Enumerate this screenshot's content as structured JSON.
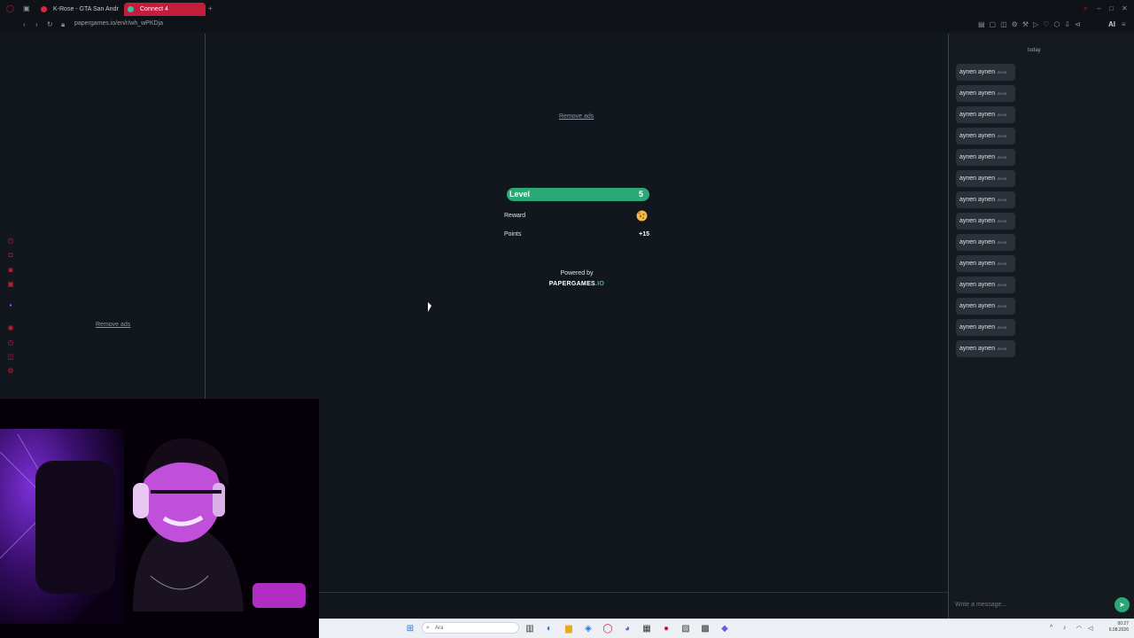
{
  "browser": {
    "tabs": [
      {
        "label": "K-Rose - GTA San Andr",
        "color": "#e0243f"
      },
      {
        "label": "Connect 4",
        "color": "#ffffff"
      }
    ],
    "new_tab": "+",
    "url": "papergames.io/en/r/wh_wPKDja",
    "ai_label": "AI",
    "accent": "#c41c3b"
  },
  "left_panel": {
    "remove_ads": "Remove ads"
  },
  "main": {
    "remove_ads": "Remove ads",
    "level": {
      "label": "Level",
      "value": "5",
      "bar_color": "#2aa876"
    },
    "reward": {
      "label": "Reward",
      "icon": "cookie-icon"
    },
    "points": {
      "label": "Points",
      "value": "+15"
    },
    "powered_by": "Powered by",
    "logo_main": "PAPERGAMES",
    "logo_tld": ".IO"
  },
  "chat": {
    "date_label": "today",
    "messages": [
      {
        "text": "aynen aynen",
        "time": "00:24"
      },
      {
        "text": "aynen aynen",
        "time": "00:24"
      },
      {
        "text": "aynen aynen",
        "time": "00:24"
      },
      {
        "text": "aynen aynen",
        "time": "00:24"
      },
      {
        "text": "aynen aynen",
        "time": "00:24"
      },
      {
        "text": "aynen aynen",
        "time": "00:24"
      },
      {
        "text": "aynen aynen",
        "time": "00:24"
      },
      {
        "text": "aynen aynen",
        "time": "00:24"
      },
      {
        "text": "aynen aynen",
        "time": "00:24"
      },
      {
        "text": "aynen aynen",
        "time": "00:24"
      },
      {
        "text": "aynen aynen",
        "time": "00:24"
      },
      {
        "text": "aynen aynen",
        "time": "00:24"
      },
      {
        "text": "aynen aynen",
        "time": "00:24"
      },
      {
        "text": "aynen aynen",
        "time": "00:24"
      }
    ],
    "input_placeholder": "Write a message...",
    "send_icon": "send-icon"
  },
  "taskbar": {
    "search_placeholder": "Ara",
    "time": "00:27",
    "date": "6.08.2026"
  }
}
